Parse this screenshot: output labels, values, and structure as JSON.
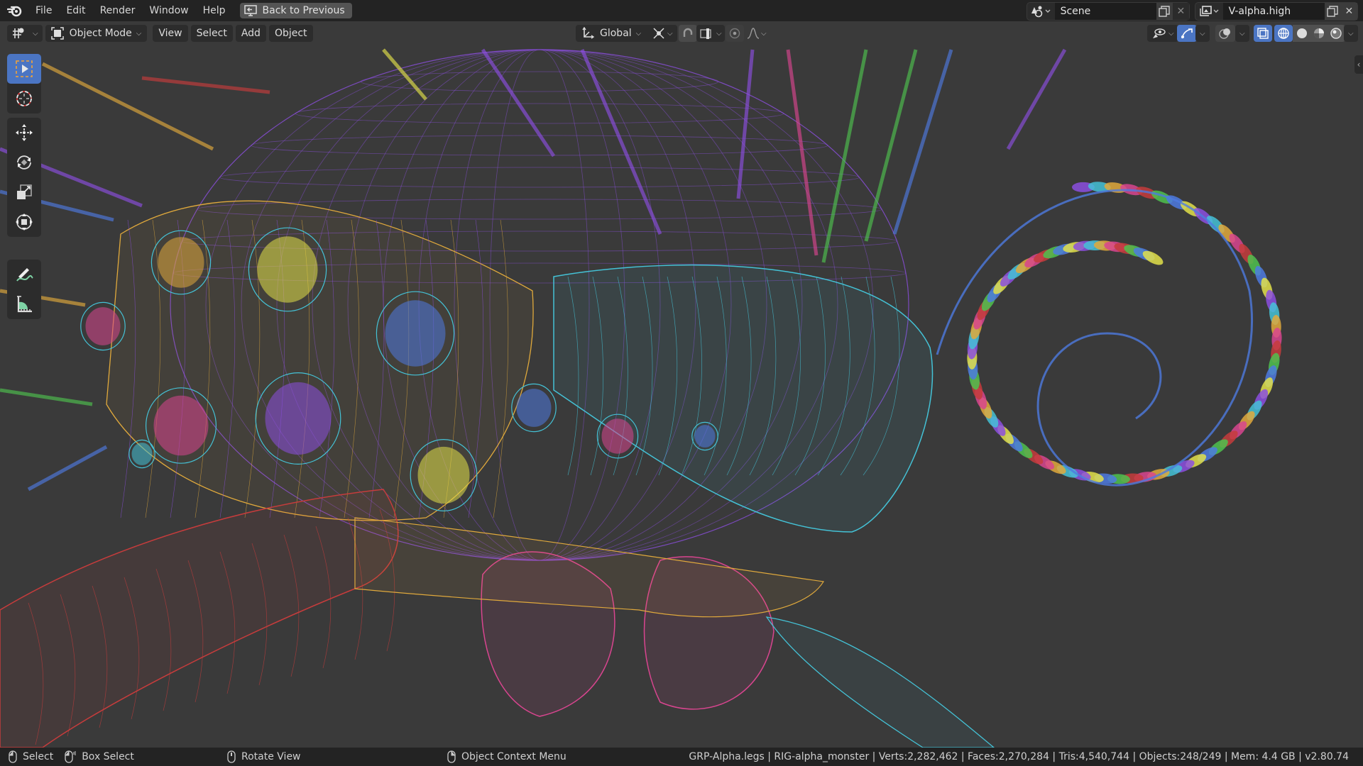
{
  "app": {
    "name": "Blender",
    "logo_icon": "blender-logo-icon"
  },
  "topbar": {
    "menus": [
      "File",
      "Edit",
      "Render",
      "Window",
      "Help"
    ],
    "back_button": "Back to Previous",
    "scene": {
      "icon": "scene-icon",
      "value": "Scene",
      "new_icon": "copy-icon",
      "close_icon": "close-icon"
    },
    "view_layer": {
      "icon": "view-layer-icon",
      "value": "V-alpha.high",
      "new_icon": "copy-icon",
      "close_icon": "close-icon"
    }
  },
  "viewport_header": {
    "editor_type_icon": "editor-type-icon",
    "mode": "Object Mode",
    "menus": [
      "View",
      "Select",
      "Add",
      "Object"
    ],
    "transform_orientation": "Global",
    "pivot_icon": "pivot-point-icon",
    "snap_icon": "snap-magnet-icon",
    "snap_increment_icon": "snap-increment-icon",
    "proportional_icon": "proportional-edit-icon",
    "falloff_icon": "falloff-curve-icon",
    "right_icons": [
      "visibility-eye-icon",
      "gizmo-icon",
      "overlay-icon",
      "xray-icon",
      "wireframe-shading-icon",
      "solid-shading-icon",
      "material-preview-icon",
      "rendered-shading-icon"
    ],
    "active_shading": "wireframe"
  },
  "toolbar": {
    "tools": [
      {
        "name": "select-box",
        "icon": "select-box-icon",
        "active": true
      },
      {
        "name": "cursor",
        "icon": "cursor-icon",
        "active": false
      },
      {
        "name": "move",
        "icon": "move-icon",
        "active": false
      },
      {
        "name": "rotate",
        "icon": "rotate-icon",
        "active": false
      },
      {
        "name": "scale",
        "icon": "scale-icon",
        "active": false
      },
      {
        "name": "transform",
        "icon": "transform-icon",
        "active": false
      },
      {
        "name": "annotate",
        "icon": "annotate-icon",
        "active": false
      },
      {
        "name": "measure",
        "icon": "measure-icon",
        "active": false
      }
    ]
  },
  "statusbar": {
    "hints": [
      {
        "icon": "mouse-left-icon",
        "label": "Select"
      },
      {
        "icon": "mouse-left-drag-icon",
        "label": "Box Select"
      },
      {
        "icon": "mouse-middle-icon",
        "label": "Rotate View"
      },
      {
        "icon": "mouse-right-icon",
        "label": "Object Context Menu"
      }
    ],
    "info": "GRP-Alpha.legs | RIG-alpha_monster | Verts:2,282,462 | Faces:2,270,284 | Tris:4,540,744 | Objects:248/249 | Mem: 4.4 GB | v2.80.74"
  },
  "colors": {
    "accent": "#4b75c3",
    "topbar_bg": "#232323",
    "viewport_bg": "#3a3a3a",
    "wire_colors": [
      "#8c4fe0",
      "#44c2d6",
      "#e0a93c",
      "#d8458f",
      "#c63c3c",
      "#4fc24f",
      "#4e7ae0",
      "#e2e04a"
    ]
  }
}
